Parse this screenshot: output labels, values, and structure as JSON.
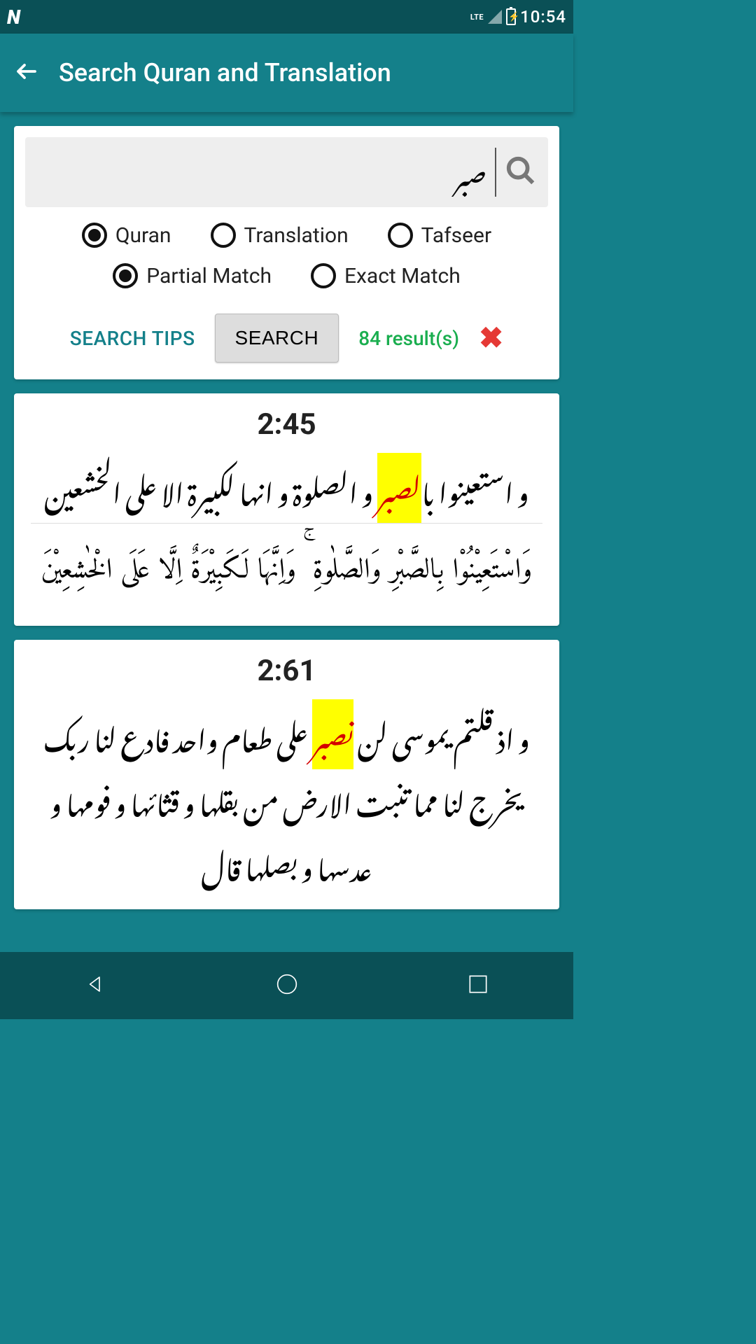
{
  "statusbar": {
    "network": "LTE",
    "time": "10:54"
  },
  "appbar": {
    "title": "Search Quran and Translation"
  },
  "search": {
    "query": "صبر",
    "scope": {
      "quran": {
        "label": "Quran",
        "selected": true
      },
      "translation": {
        "label": "Translation",
        "selected": false
      },
      "tafseer": {
        "label": "Tafseer",
        "selected": false
      }
    },
    "match": {
      "partial": {
        "label": "Partial Match",
        "selected": true
      },
      "exact": {
        "label": "Exact Match",
        "selected": false
      }
    },
    "tips_label": "SEARCH TIPS",
    "search_label": "SEARCH",
    "results_label": "84 result(s)"
  },
  "results": [
    {
      "ref": "2:45",
      "line1_pre": "و استعینوا با",
      "line1_hl": "لصبر",
      "line1_post": " و الصلوة و انها لکبیرة الا علی الخشعین",
      "line2": "وَاسْتَعِيْنُوْا بِالصَّبْرِ وَالصَّلٰوةِ ۚ وَاِنَّهَا لَكَبِيْرَةٌ اِلَّا عَلَى الْخٰشِعِيْنَ"
    },
    {
      "ref": "2:61",
      "line1_pre": "و اذ قلتم یموسی لن ",
      "line1_hl": "نصبر",
      "line1_post": " علی طعام واحد فادع لنا ربک یخرج لنا مما تنبت الارض من بقلها و قثائها و فومها و عدسها و بصلها قال"
    }
  ]
}
